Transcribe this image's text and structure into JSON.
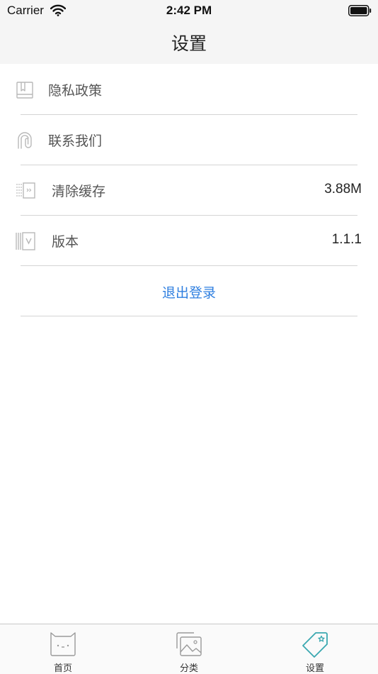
{
  "status_bar": {
    "carrier": "Carrier",
    "time": "2:42 PM",
    "icons": [
      "wifi-icon",
      "battery-icon"
    ]
  },
  "nav": {
    "title": "设置"
  },
  "settings": {
    "items": [
      {
        "label": "隐私政策",
        "value": "",
        "icon": "book-icon"
      },
      {
        "label": "联系我们",
        "value": "",
        "icon": "contact-icon"
      },
      {
        "label": "清除缓存",
        "value": "3.88M",
        "icon": "clear-cache-icon"
      },
      {
        "label": "版本",
        "value": "1.1.1",
        "icon": "version-icon"
      }
    ],
    "logout_label": "退出登录"
  },
  "tab_bar": {
    "tabs": [
      {
        "label": "首页",
        "icon": "home-face-icon",
        "active": false
      },
      {
        "label": "分类",
        "icon": "gallery-icon",
        "active": false
      },
      {
        "label": "设置",
        "icon": "tag-star-icon",
        "active": true
      }
    ]
  },
  "colors": {
    "accent": "#2f7fe0",
    "tab_active": "#3aa8b0",
    "icon_gray": "#b8b8b8"
  }
}
